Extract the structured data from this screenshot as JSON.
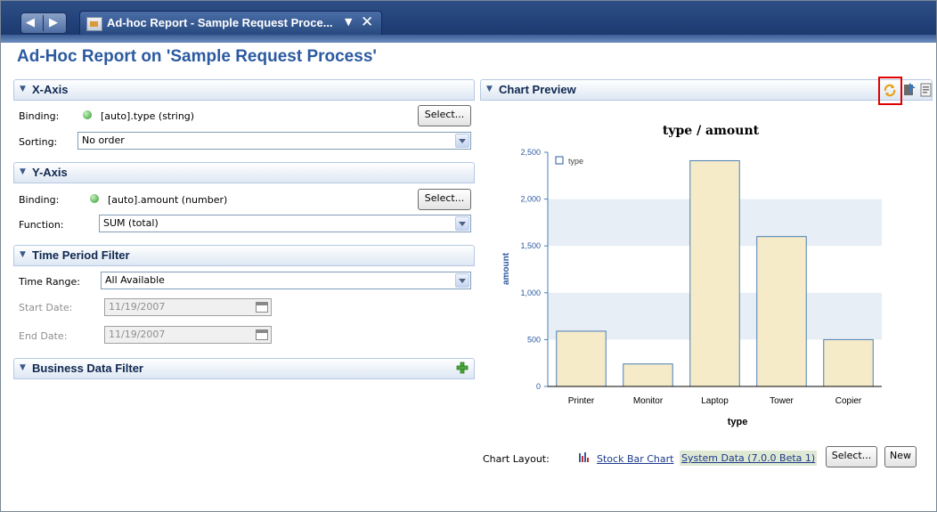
{
  "window": {
    "tab_title": "Ad-hoc Report - Sample Request Proce..."
  },
  "page": {
    "title": "Ad-Hoc Report on 'Sample Request Process'"
  },
  "x_axis": {
    "header": "X-Axis",
    "binding_label": "Binding:",
    "binding_value": "[auto].type (string)",
    "select_label": "Select...",
    "sorting_label": "Sorting:",
    "sorting_value": "No order"
  },
  "y_axis": {
    "header": "Y-Axis",
    "binding_label": "Binding:",
    "binding_value": "[auto].amount (number)",
    "select_label": "Select...",
    "function_label": "Function:",
    "function_value": "SUM (total)"
  },
  "time_filter": {
    "header": "Time Period Filter",
    "range_label": "Time Range:",
    "range_value": "All Available",
    "start_label": "Start Date:",
    "start_value": "11/19/2007",
    "end_label": "End Date:",
    "end_value": "11/19/2007"
  },
  "business_filter": {
    "header": "Business Data Filter"
  },
  "chart_preview": {
    "header": "Chart Preview"
  },
  "chart_layout": {
    "label": "Chart Layout:",
    "layout_link": "Stock Bar Chart",
    "source_link": "System Data (7.0.0 Beta 1)",
    "select_label": "Select...",
    "new_label": "New"
  },
  "colors": {
    "bar_fill": "#f5ebc9",
    "bar_stroke": "#4a7fb5",
    "band_fill": "#e8eef5",
    "title_blue": "#2c5aa0",
    "highlight_red": "#e00000"
  },
  "chart_data": {
    "type": "bar",
    "title": "type / amount",
    "xlabel": "type",
    "ylabel": "amount",
    "categories": [
      "Printer",
      "Monitor",
      "Laptop",
      "Tower",
      "Copier"
    ],
    "series": [
      {
        "name": "type",
        "values": [
          590,
          240,
          2410,
          1600,
          500
        ]
      }
    ],
    "ylim": [
      0,
      2500
    ],
    "yticks": [
      "0",
      "500",
      "1,000",
      "1,500",
      "2,000",
      "2,500"
    ],
    "legend": "top-left",
    "grid": "alternating bands"
  }
}
